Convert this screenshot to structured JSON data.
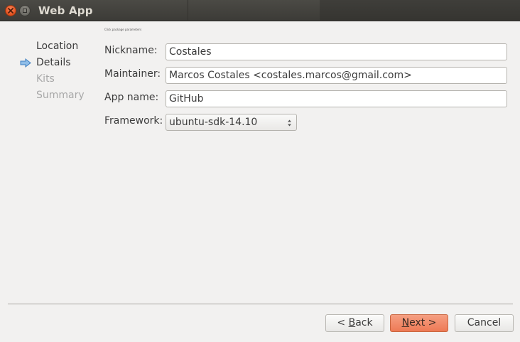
{
  "window": {
    "title": "Web App"
  },
  "wizard": {
    "subtitle": "Click package parameters",
    "steps": [
      {
        "label": "Location",
        "state": "done"
      },
      {
        "label": "Details",
        "state": "current"
      },
      {
        "label": "Kits",
        "state": "pending"
      },
      {
        "label": "Summary",
        "state": "pending"
      }
    ]
  },
  "form": {
    "nickname": {
      "label": "Nickname:",
      "value": "Costales"
    },
    "maintainer": {
      "label": "Maintainer:",
      "value": "Marcos Costales <costales.marcos@gmail.com>"
    },
    "app_name": {
      "label": "App name:",
      "value": "GitHub"
    },
    "framework": {
      "label": "Framework:",
      "value": "ubuntu-sdk-14.10"
    }
  },
  "buttons": {
    "back": {
      "mnemonic_prefix": "< ",
      "mnemonic": "B",
      "rest": "ack"
    },
    "next": {
      "mnemonic": "N",
      "rest": "ext >"
    },
    "cancel": {
      "label": "Cancel"
    }
  },
  "colors": {
    "accent": "#ee7a55",
    "arrow": "#5b9bd5",
    "window_bg": "#f2f1f0"
  }
}
